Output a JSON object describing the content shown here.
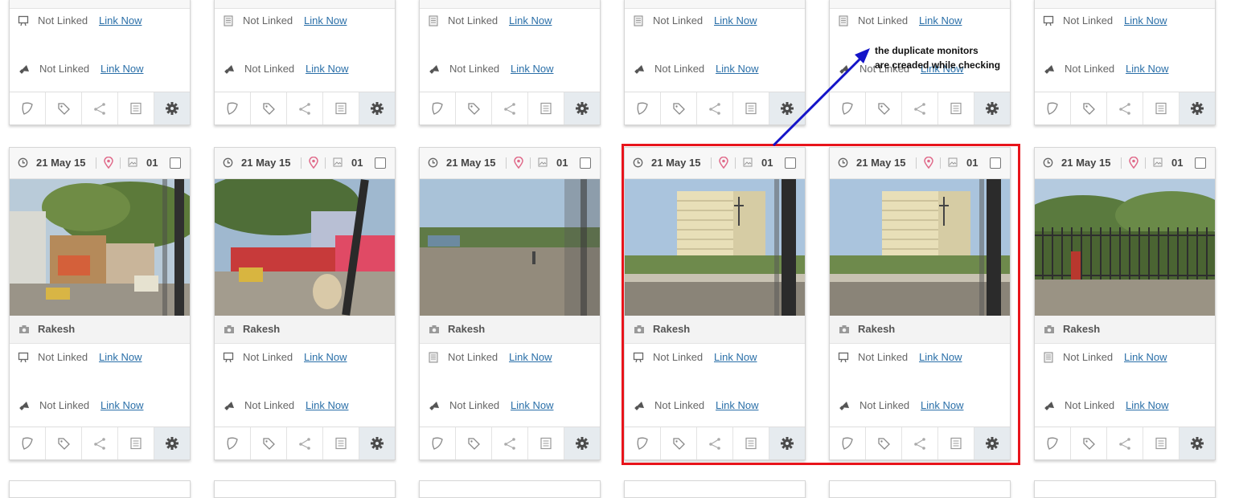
{
  "cards": {
    "date": "21 May 15",
    "count": "01",
    "owner": "Rakesh",
    "not_linked": "Not Linked",
    "link_now": "Link Now"
  },
  "annotation": {
    "line1": "the duplicate monitors",
    "line2": "are creaded while checking"
  },
  "icons": {
    "row1_top": [
      "monitor-icon",
      "document-icon",
      "document-icon",
      "document-icon",
      "document-icon",
      "monitor-icon"
    ],
    "row1_mid": [
      "monitor-icon",
      "monitor-icon",
      "document-icon",
      "monitor-icon",
      "monitor-icon",
      "document-icon"
    ],
    "row2": "megaphone-icon",
    "toolbar": [
      "shield-icon",
      "tag-icon",
      "share-icon",
      "list-icon",
      "gear-icon"
    ]
  },
  "colors": {
    "link": "#2a6fa8",
    "highlight_box": "#e8141b",
    "arrow": "#1414c8",
    "pin": "#e06a8a",
    "toolbar_active": "#e6ebef"
  },
  "photos": [
    "street-with-tree-and-bus",
    "street-with-tree-and-bus-window",
    "open-road-with-pedestrian",
    "white-office-building",
    "white-office-building",
    "trees-and-iron-fence-with-pedestrian"
  ]
}
